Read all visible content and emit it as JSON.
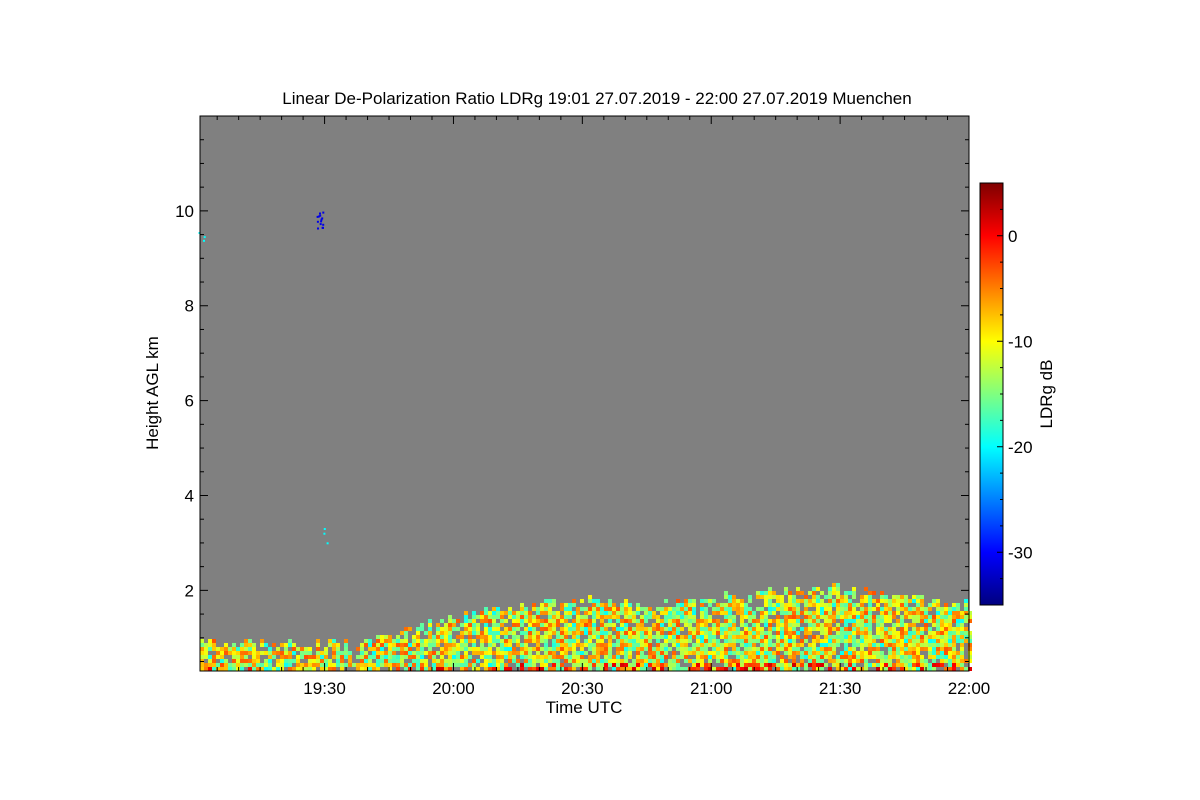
{
  "chart_data": {
    "type": "heatmap",
    "title": "Linear De-Polarization Ratio LDRg   19:01 27.07.2019 - 22:00 27.07.2019 Muenchen",
    "xlabel": "Time UTC",
    "ylabel": "Height AGL km",
    "x_ticks": [
      "19:30",
      "20:00",
      "20:30",
      "21:00",
      "21:30",
      "22:00"
    ],
    "x_tick_values": [
      19.5,
      20.0,
      20.5,
      21.0,
      21.5,
      22.0
    ],
    "xlim": [
      19.0167,
      22.0
    ],
    "y_ticks": [
      "2",
      "4",
      "6",
      "8",
      "10"
    ],
    "y_tick_values": [
      2,
      4,
      6,
      8,
      10
    ],
    "ylim": [
      0.3,
      12.0
    ],
    "colorbar": {
      "label": "LDRg dB",
      "range": [
        -35,
        5
      ],
      "ticks": [
        "0",
        "-10",
        "-20",
        "-30"
      ],
      "tick_values": [
        0,
        -10,
        -20,
        -30
      ],
      "colormap": "jet"
    },
    "background_color": "#808080",
    "aerosol_layer_top_km": {
      "x": [
        19.02,
        19.3,
        19.5,
        19.7,
        19.9,
        20.1,
        20.3,
        20.5,
        20.7,
        20.9,
        21.1,
        21.3,
        21.5,
        21.7,
        21.9,
        22.0
      ],
      "y": [
        0.95,
        0.95,
        0.9,
        1.0,
        1.3,
        1.6,
        1.7,
        1.8,
        1.75,
        1.8,
        1.9,
        2.0,
        2.1,
        2.0,
        1.8,
        1.7
      ]
    },
    "features": [
      {
        "x": 19.48,
        "y": 9.8,
        "ldr_db": -31
      },
      {
        "x": 19.02,
        "y": 9.35,
        "ldr_db": -20
      },
      {
        "x": 19.5,
        "y": 3.2,
        "ldr_db": -20
      }
    ]
  }
}
